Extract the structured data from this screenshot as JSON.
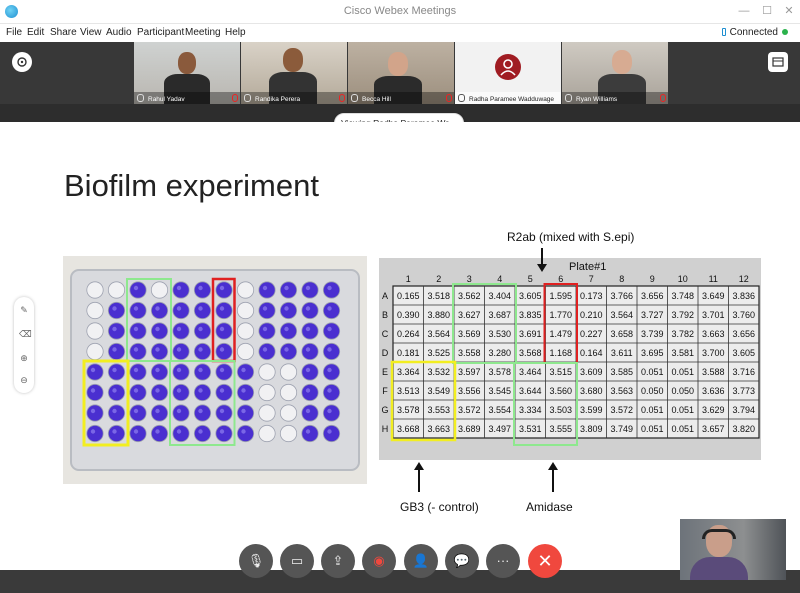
{
  "window": {
    "title": "Cisco Webex Meetings",
    "minimize": "—",
    "maximize": "☐",
    "close": "✕"
  },
  "menu": {
    "items": [
      "File",
      "Edit",
      "Share",
      "View",
      "Audio",
      "Participant",
      "Meeting",
      "Help"
    ],
    "status": "Connected"
  },
  "participants": [
    {
      "name": "Rahul Yadav"
    },
    {
      "name": "Randika Perera"
    },
    {
      "name": "Becca Hill"
    },
    {
      "name": "Radha Paramee Wadduwage"
    },
    {
      "name": "Ryan Williams"
    }
  ],
  "viewing_label": "Viewing Radha Paramee Wa...",
  "slide": {
    "title": "Biofilm experiment",
    "labels": {
      "top_right": "R2ab (mixed with S.epi)",
      "bottom_left": "GB3 (- control)",
      "bottom_right": "Amidase"
    },
    "plate": {
      "title": "Plate#1",
      "columns": [
        "1",
        "2",
        "3",
        "4",
        "5",
        "6",
        "7",
        "8",
        "9",
        "10",
        "11",
        "12"
      ],
      "rows": [
        {
          "label": "A",
          "values": [
            "0.165",
            "3.518",
            "3.562",
            "3.404",
            "3.605",
            "1.595",
            "0.173",
            "3.766",
            "3.656",
            "3.748",
            "3.649",
            "3.836"
          ]
        },
        {
          "label": "B",
          "values": [
            "0.390",
            "3.880",
            "3.627",
            "3.687",
            "3.835",
            "1.770",
            "0.210",
            "3.564",
            "3.727",
            "3.792",
            "3.701",
            "3.760"
          ]
        },
        {
          "label": "C",
          "values": [
            "0.264",
            "3.564",
            "3.569",
            "3.530",
            "3.691",
            "1.479",
            "0.227",
            "3.658",
            "3.739",
            "3.782",
            "3.663",
            "3.656"
          ]
        },
        {
          "label": "D",
          "values": [
            "0.181",
            "3.525",
            "3.558",
            "3.280",
            "3.568",
            "1.168",
            "0.164",
            "3.611",
            "3.695",
            "3.581",
            "3.700",
            "3.605"
          ]
        },
        {
          "label": "E",
          "values": [
            "3.364",
            "3.532",
            "3.597",
            "3.578",
            "3.464",
            "3.515",
            "3.609",
            "3.585",
            "0.051",
            "0.051",
            "3.588",
            "3.716"
          ]
        },
        {
          "label": "F",
          "values": [
            "3.513",
            "3.549",
            "3.556",
            "3.545",
            "3.644",
            "3.560",
            "3.680",
            "3.563",
            "0.050",
            "0.050",
            "3.636",
            "3.773"
          ]
        },
        {
          "label": "G",
          "values": [
            "3.578",
            "3.553",
            "3.572",
            "3.554",
            "3.334",
            "3.503",
            "3.599",
            "3.572",
            "0.051",
            "0.051",
            "3.629",
            "3.794"
          ]
        },
        {
          "label": "H",
          "values": [
            "3.668",
            "3.663",
            "3.689",
            "3.497",
            "3.531",
            "3.555",
            "3.809",
            "3.749",
            "0.051",
            "0.051",
            "3.657",
            "3.820"
          ]
        }
      ]
    },
    "well_plate_image": {
      "filled": [
        "..P.PPP.PPPP",
        ".PPPPPP.PPPP",
        ".PPPPPP.PPPP",
        ".PPPPPP.PPPP",
        "PPPPPPPP..PP",
        "PPPPPPPP..PP",
        "PPPPPPPP..PP",
        "PPPPPPPP..PP"
      ]
    }
  },
  "colors": {
    "title_text": "#222222",
    "connected_dot": "#2bb24c",
    "end_call": "#f0483e",
    "box_red": "#e02020",
    "box_green": "#8ee88e",
    "box_yellow": "#f2ee20",
    "well_purple": "#4a2fd0"
  },
  "controls": [
    {
      "name": "mute-button",
      "icon": "mic-off-icon",
      "glyph": "🎙"
    },
    {
      "name": "video-button",
      "icon": "video-off-icon",
      "glyph": "▭"
    },
    {
      "name": "share-button",
      "icon": "share-icon",
      "glyph": "⇪"
    },
    {
      "name": "record-button",
      "icon": "record-icon",
      "glyph": "◉"
    },
    {
      "name": "participants-button",
      "icon": "participants-icon",
      "glyph": "👤"
    },
    {
      "name": "chat-button",
      "icon": "chat-icon",
      "glyph": "💬"
    },
    {
      "name": "more-button",
      "icon": "more-icon",
      "glyph": "···"
    },
    {
      "name": "end-call-button",
      "icon": "close-icon",
      "glyph": "✕"
    }
  ]
}
